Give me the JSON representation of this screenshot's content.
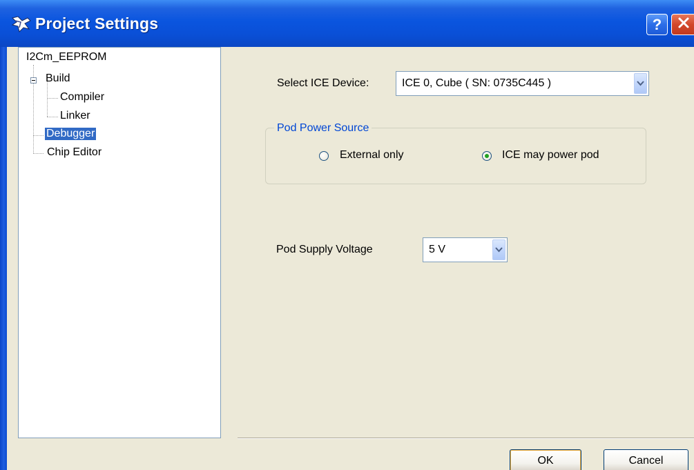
{
  "window": {
    "title": "Project Settings",
    "icon": "project-settings-icon"
  },
  "titlebar_buttons": {
    "help": "?",
    "close": "close-icon"
  },
  "tree": {
    "root": "I2Cm_EEPROM",
    "items": [
      {
        "label": "Build",
        "expanded": true
      },
      {
        "label": "Compiler"
      },
      {
        "label": "Linker"
      },
      {
        "label": "Debugger",
        "selected": true
      },
      {
        "label": "Chip Editor"
      }
    ]
  },
  "ice_device": {
    "label": "Select ICE Device:",
    "value": "ICE 0, Cube ( SN: 0735C445 )"
  },
  "pod_power": {
    "legend": "Pod Power Source",
    "options": [
      {
        "label": "External only",
        "checked": false
      },
      {
        "label": "ICE may power pod",
        "checked": true
      }
    ]
  },
  "pod_voltage": {
    "label": "Pod Supply Voltage",
    "value": "5 V"
  },
  "buttons": {
    "ok": "OK",
    "cancel": "Cancel"
  },
  "colors": {
    "titlebar": "#0a55df",
    "selection": "#316ac5",
    "group_legend": "#0046d5",
    "dialog_bg": "#ece9d8"
  }
}
